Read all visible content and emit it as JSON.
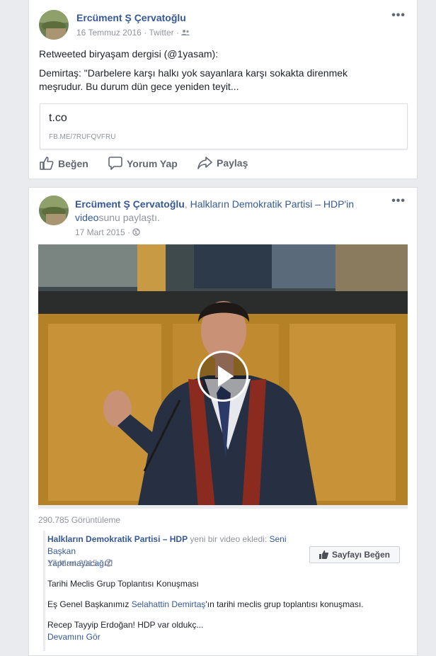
{
  "post1": {
    "author": "Ercüment Ş Çervatoğlu",
    "date": "16 Temmuz 2016",
    "via": "Twitter",
    "more_label": "•••",
    "line1": "Retweeted biryaşam dergisi (@1yasam):",
    "line2": "Demirtaş: \"Darbelere karşı halkı yok sayanlara karşı sokakta direnmek",
    "line3": "meşrudur. Bu durum dün gece yeniden teyit...",
    "preview_title": "t.co",
    "preview_domain": "FB.ME/7RUFQVFRU",
    "actions": {
      "like": "Beğen",
      "comment": "Yorum Yap",
      "share": "Paylaş"
    }
  },
  "post2": {
    "author": "Ercüment Ş Çervatoğlu",
    "page": "Halkların Demokratik Partisi – HDP",
    "page_suffix": "'in",
    "video_word": "video",
    "shared_suffix": "sunu paylaştı.",
    "date": "17 Mart 2015",
    "more_label": "•••",
    "views": "290.785 Görüntüleme",
    "inner": {
      "page": "Halkların Demokratik Partisi – HDP",
      "added": " yeni bir video ekledi: ",
      "video_title_1": "Seni Başkan",
      "video_title_2": "Yaptırmayacağız!",
      "date": "17 Mart 2015",
      "like_page": "Sayfayı Beğen",
      "desc1": "Tarihi Meclis Grup Toplantısı Konuşması",
      "desc2_pre": "Eş Genel Başkanımız ",
      "desc2_link": "Selahattin Demirtaş",
      "desc2_post": "'ın tarihi meclis grup toplantısı konuşması.",
      "desc3": "Recep Tayyip Erdoğan! HDP var oldukç...",
      "see_more": "Devamını Gör"
    }
  },
  "icons": [
    "friends-icon",
    "globe-icon",
    "like-icon",
    "comment-icon",
    "share-icon",
    "play-icon",
    "thumbs-up-icon"
  ]
}
